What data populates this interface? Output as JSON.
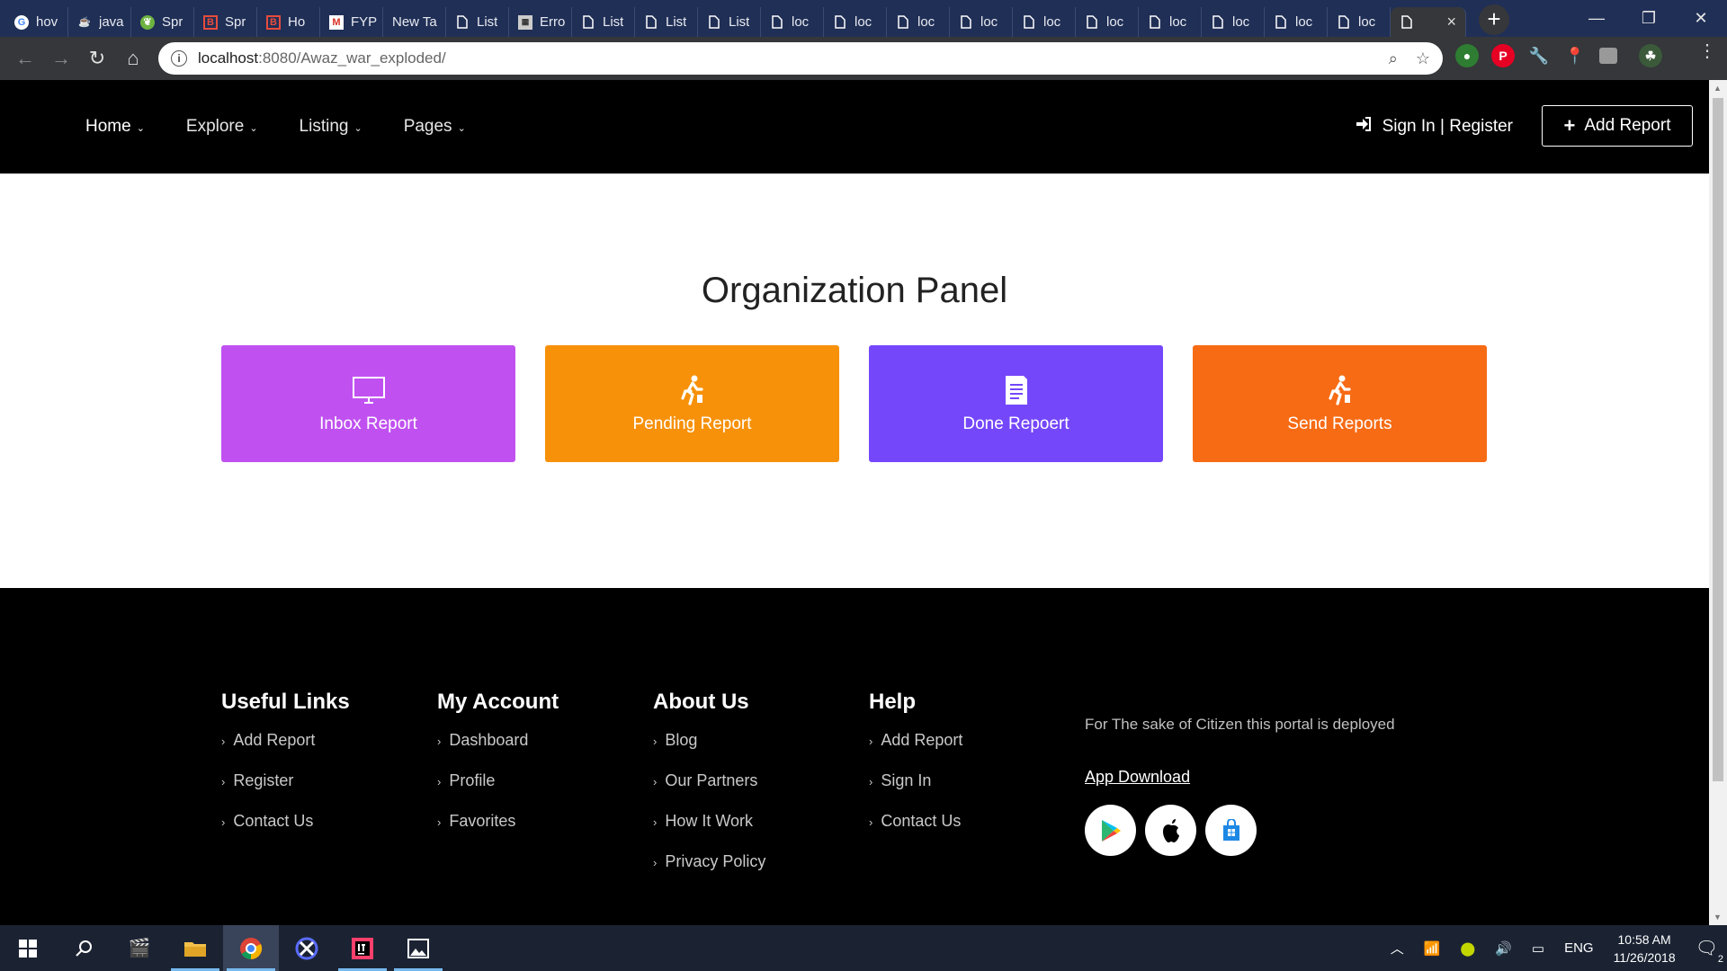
{
  "browser": {
    "tabs": [
      {
        "title": "hov",
        "icon": "google-icon"
      },
      {
        "title": "java",
        "icon": "java-icon"
      },
      {
        "title": "Spr",
        "icon": "spring-icon"
      },
      {
        "title": "Spr",
        "icon": "bootstrap-icon"
      },
      {
        "title": "Ho",
        "icon": "bootstrap-icon"
      },
      {
        "title": "FYP",
        "icon": "gmail-icon"
      },
      {
        "title": "New Ta",
        "icon": "none"
      },
      {
        "title": "List",
        "icon": "page-icon"
      },
      {
        "title": "Erro",
        "icon": "error-page-icon"
      },
      {
        "title": "List",
        "icon": "page-icon"
      },
      {
        "title": "List",
        "icon": "page-icon"
      },
      {
        "title": "List",
        "icon": "page-icon"
      },
      {
        "title": "loc",
        "icon": "page-icon"
      },
      {
        "title": "loc",
        "icon": "page-icon"
      },
      {
        "title": "loc",
        "icon": "page-icon"
      },
      {
        "title": "loc",
        "icon": "page-icon"
      },
      {
        "title": "loc",
        "icon": "page-icon"
      },
      {
        "title": "loc",
        "icon": "page-icon"
      },
      {
        "title": "loc",
        "icon": "page-icon"
      },
      {
        "title": "loc",
        "icon": "page-icon"
      },
      {
        "title": "loc",
        "icon": "page-icon"
      },
      {
        "title": "loc",
        "icon": "page-icon"
      }
    ],
    "url_host": "localhost",
    "url_rest": ":8080/Awaz_war_exploded/",
    "colors": {
      "tabbar": "#202f56",
      "toolbar": "#35373a"
    }
  },
  "header": {
    "nav": [
      {
        "label": "Home"
      },
      {
        "label": "Explore"
      },
      {
        "label": "Listing"
      },
      {
        "label": "Pages"
      }
    ],
    "signin_label": "Sign In | Register",
    "add_report_label": "Add Report"
  },
  "panel": {
    "title": "Organization Panel",
    "cards": [
      {
        "label": "Inbox Report",
        "color": "#c051f0",
        "icon": "monitor-icon"
      },
      {
        "label": "Pending Report",
        "color": "#f7910a",
        "icon": "walking-person-icon"
      },
      {
        "label": "Done Repoert",
        "color": "#7447fb",
        "icon": "document-icon"
      },
      {
        "label": "Send Reports",
        "color": "#f76b14",
        "icon": "walking-person-icon"
      }
    ]
  },
  "footer": {
    "columns": [
      {
        "heading": "Useful Links",
        "links": [
          "Add Report",
          "Register",
          "Contact Us"
        ]
      },
      {
        "heading": "My Account",
        "links": [
          "Dashboard",
          "Profile",
          "Favorites"
        ]
      },
      {
        "heading": "About Us",
        "links": [
          "Blog",
          "Our Partners",
          "How It Work",
          "Privacy Policy"
        ]
      },
      {
        "heading": "Help",
        "links": [
          "Add Report",
          "Sign In",
          "Contact Us"
        ]
      }
    ],
    "about_text": "For The sake of Citizen this portal is deployed",
    "app_download_label": "App Download",
    "stores": [
      "google-play-icon",
      "apple-icon",
      "windows-store-icon"
    ]
  },
  "taskbar": {
    "language": "ENG",
    "time": "10:58 AM",
    "date": "11/26/2018",
    "notification_count": "2"
  }
}
